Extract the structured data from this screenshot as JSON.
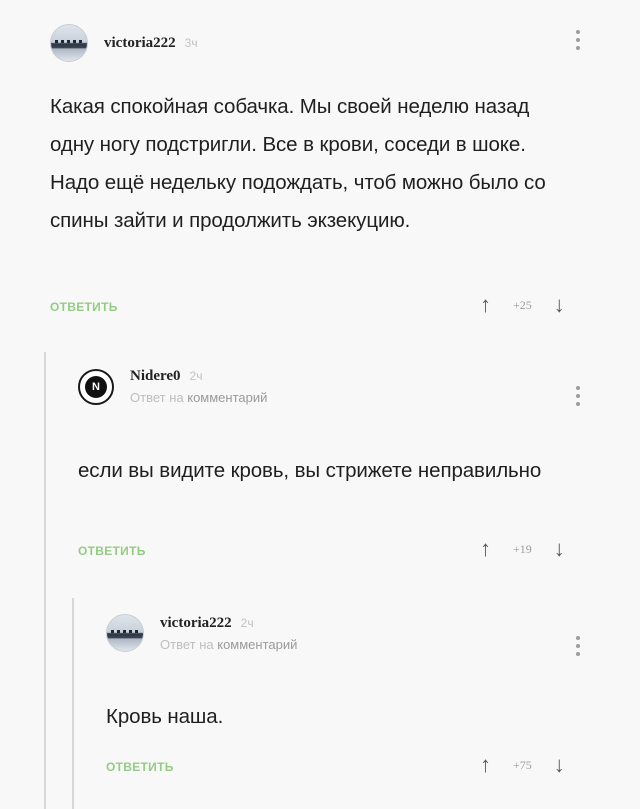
{
  "comments": [
    {
      "username": "victoria222",
      "time": "3ч",
      "text": "Какая спокойная собачка. Мы своей неделю назад одну ногу подстригли. Все в крови, соседи в шоке. Надо ещё недельку подождать, чтоб можно было со спины зайти и продолжить экзекуцию.",
      "reply_label": "ОТВЕТИТЬ",
      "rating": "+25",
      "avatar_icon": "photo-avatar-icon"
    },
    {
      "username": "Nidere0",
      "time": "2ч",
      "reply_prefix": "Ответ на",
      "reply_target": "комментарий",
      "text": "если вы видите кровь, вы стрижете неправильно",
      "reply_label": "ОТВЕТИТЬ",
      "rating": "+19",
      "avatar_letter": "N",
      "avatar_icon": "n-logo-avatar-icon"
    },
    {
      "username": "victoria222",
      "time": "2ч",
      "reply_prefix": "Ответ на",
      "reply_target": "комментарий",
      "text": "Кровь наша.",
      "reply_label": "ОТВЕТИТЬ",
      "rating": "+75",
      "avatar_icon": "photo-avatar-icon"
    }
  ],
  "icons": {
    "upvote": "↑",
    "downvote": "↓",
    "more": "more-vertical-icon"
  },
  "colors": {
    "reply_link": "#94cc84",
    "background": "#f8f8f8",
    "thread_line": "#d8d8d8"
  }
}
